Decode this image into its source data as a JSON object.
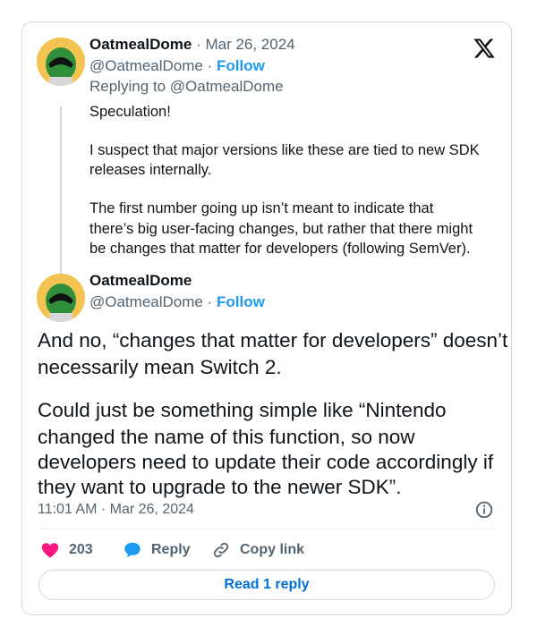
{
  "tweet1": {
    "name": "OatmealDome",
    "date": "· Mar 26, 2024",
    "handle": "@OatmealDome",
    "dot": "·",
    "follow": "Follow",
    "replying_to": "Replying to @OatmealDome",
    "lines": [
      "Speculation!",
      "I suspect that major versions like these are tied to new SDK",
      "releases internally.",
      "The first number going up isn’t meant to indicate that",
      "there’s big user-facing changes, but rather that there might",
      "be changes that matter for developers (following SemVer)."
    ]
  },
  "tweet2": {
    "name": "OatmealDome",
    "handle": "@OatmealDome",
    "dot": "·",
    "follow": "Follow",
    "lines": [
      "And no, “changes that matter for developers” doesn’t",
      "necessarily mean Switch 2.",
      "Could just be something simple like “Nintendo",
      "changed the name of this function, so now",
      "developers need to update their code accordingly if",
      "they want to upgrade to the newer SDK”."
    ],
    "timestamp": "11:01 AM · Mar 26, 2024"
  },
  "actions": {
    "like_count": "203",
    "reply_label": "Reply",
    "copy_link_label": "Copy link"
  },
  "read_reply_label": "Read 1 reply",
  "colors": {
    "accent": "#1d9bf0",
    "like": "#f91880",
    "muted": "#536471"
  }
}
